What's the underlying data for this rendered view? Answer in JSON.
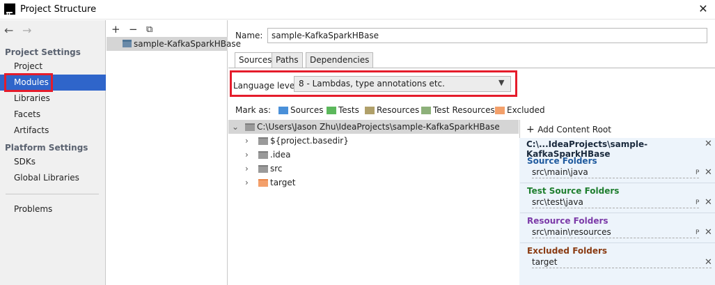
{
  "window": {
    "title": "Project Structure",
    "app_icon_text": "IJ"
  },
  "sidebar": {
    "back_icon": "←",
    "forward_icon": "→",
    "sections": [
      {
        "header": "Project Settings",
        "items": [
          "Project",
          "Modules",
          "Libraries",
          "Facets",
          "Artifacts"
        ]
      },
      {
        "header": "Platform Settings",
        "items": [
          "SDKs",
          "Global Libraries"
        ]
      }
    ],
    "problems": "Problems",
    "selected": "Modules"
  },
  "modules_toolbar": {
    "add": "+",
    "remove": "−",
    "copy": "⧉"
  },
  "modules": [
    {
      "name": "sample-KafkaSparkHBase"
    }
  ],
  "main": {
    "name_label": "Name:",
    "name_value": "sample-KafkaSparkHBase",
    "tabs": [
      "Sources",
      "Paths",
      "Dependencies"
    ],
    "active_tab": "Sources",
    "language_level_label": "Language level:",
    "language_level_value": "8 - Lambdas, type annotations etc.",
    "mark_as_label": "Mark as:",
    "mark_as": [
      "Sources",
      "Tests",
      "Resources",
      "Test Resources",
      "Excluded"
    ],
    "tree": {
      "root": "C:\\Users\\Jason Zhu\\IdeaProjects\\sample-KafkaSparkHBase",
      "children": [
        "${project.basedir}",
        ".idea",
        "src",
        "target"
      ]
    }
  },
  "content_root_panel": {
    "add_label": "Add Content Root",
    "root_path": "C:\\...IdeaProjects\\sample-KafkaSparkHBase",
    "groups": [
      {
        "title": "Source Folders",
        "path": "src\\main\\java",
        "color": "#1f5a9e"
      },
      {
        "title": "Test Source Folders",
        "path": "src\\test\\java",
        "color": "#1e7e2e"
      },
      {
        "title": "Resource Folders",
        "path": "src\\main\\resources",
        "color": "#7b3aa8"
      },
      {
        "title": "Excluded Folders",
        "path": "target",
        "color": "#8a3b12"
      }
    ]
  },
  "colors": {
    "selection": "#2f65ca",
    "highlight_box": "#e51c2b"
  }
}
